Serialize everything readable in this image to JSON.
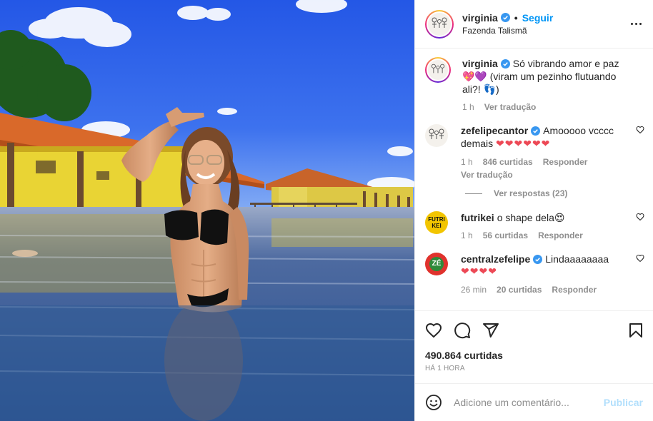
{
  "post": {
    "username": "virginia",
    "follow_label": "Seguir",
    "dot": "•",
    "location": "Fazenda Talismã",
    "photo_alt": "Foto de virginia"
  },
  "caption": {
    "username": "virginia",
    "text": "Só vibrando amor e paz 💖💜 (viram um pezinho flutuando ali?! 👣)",
    "time": "1 h",
    "translate": "Ver tradução"
  },
  "comments": [
    {
      "username": "zefelipecantor",
      "verified": true,
      "text": "Amooooo vcccc demais",
      "hearts": "❤❤❤❤❤❤",
      "time": "1 h",
      "likes": "846 curtidas",
      "reply": "Responder",
      "translate": "Ver tradução",
      "avatar": "cartoon-family-avatar",
      "view_replies": "Ver respostas (23)"
    },
    {
      "username": "futrikei",
      "verified": false,
      "text": "o shape dela😍",
      "hearts": "",
      "time": "1 h",
      "likes": "56 curtidas",
      "reply": "Responder",
      "avatar": "futrikei-logo",
      "avatar_text": "FUTRI KEI"
    },
    {
      "username": "centralzefelipe",
      "verified": true,
      "text": "Lindaaaaaaaa",
      "hearts": "❤❤❤❤",
      "time": "26 min",
      "likes": "20 curtidas",
      "reply": "Responder",
      "avatar": "ze-logo",
      "avatar_text": "ZÉ"
    }
  ],
  "actions": {
    "like": "heart-icon",
    "comment": "comment-icon",
    "share": "share-icon",
    "save": "bookmark-icon"
  },
  "likes_count": "490.864 curtidas",
  "posted_time": "HÁ 1 HORA",
  "add_comment": {
    "placeholder": "Adicione um comentário...",
    "publish_label": "Publicar"
  },
  "colors": {
    "link_blue": "#0095f6",
    "publish_disabled": "#b2dffc",
    "heart_red": "#ed4956",
    "secondary_text": "#8e8e8e",
    "verified_blue": "#3897f0"
  }
}
